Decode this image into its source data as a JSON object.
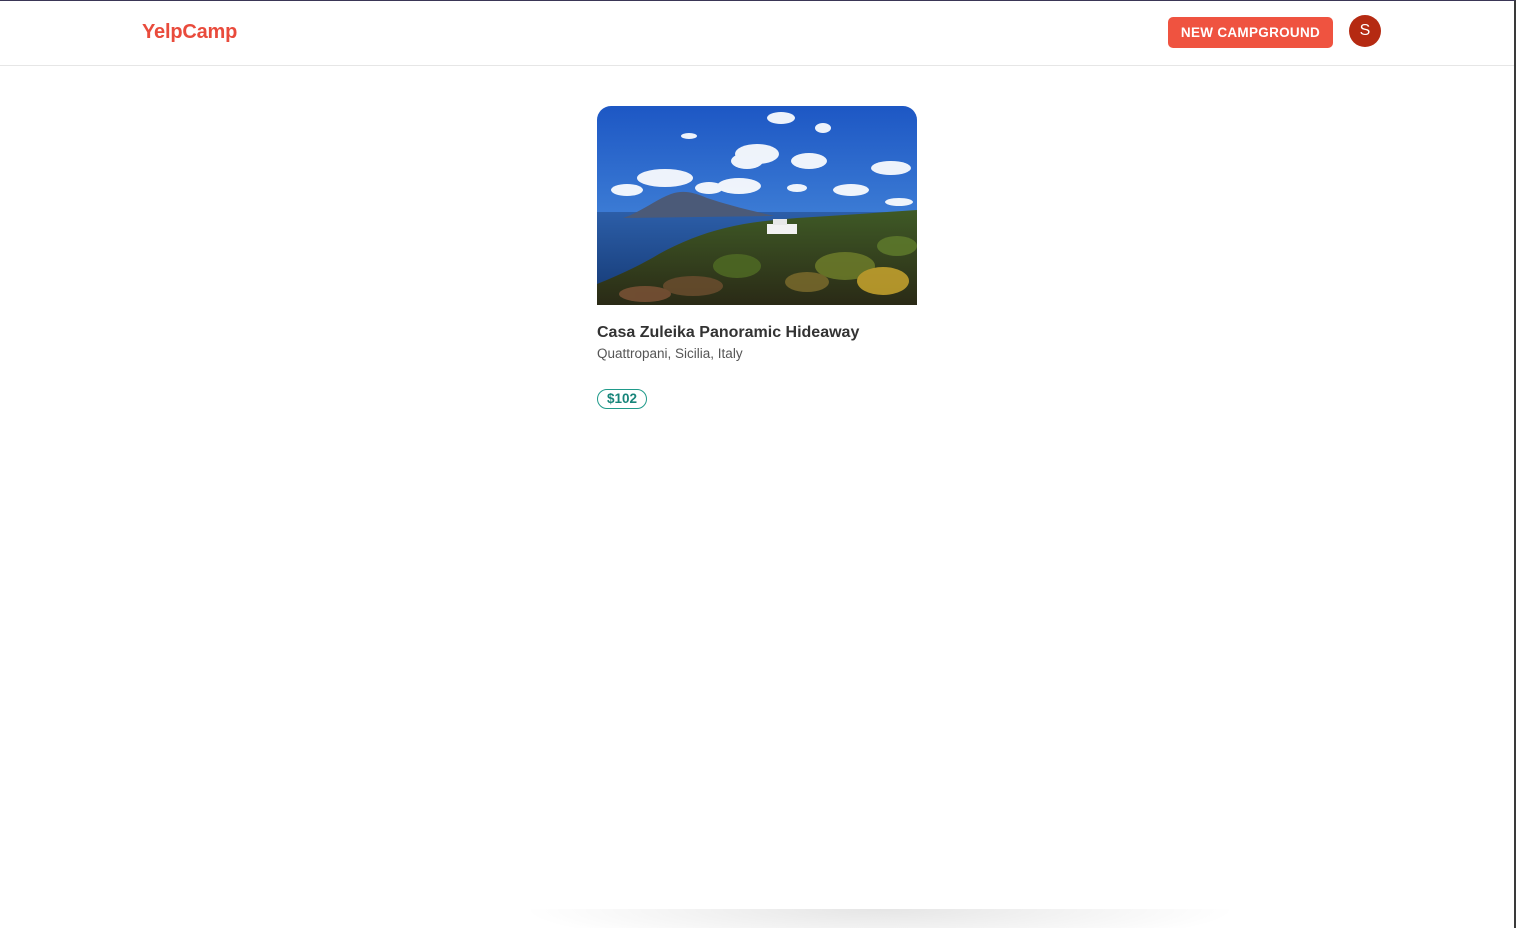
{
  "navbar": {
    "logo": "YelpCamp",
    "new_campground_label": "NEW CAMPGROUND",
    "avatar_initial": "S"
  },
  "campgrounds": [
    {
      "title": "Casa Zuleika Panoramic Hideaway",
      "location": "Quattropani, Sicilia, Italy",
      "price": "$102"
    }
  ],
  "colors": {
    "brand": "#e94b3c",
    "button": "#ef5340",
    "avatar": "#b52a12",
    "price": "#17857a"
  }
}
